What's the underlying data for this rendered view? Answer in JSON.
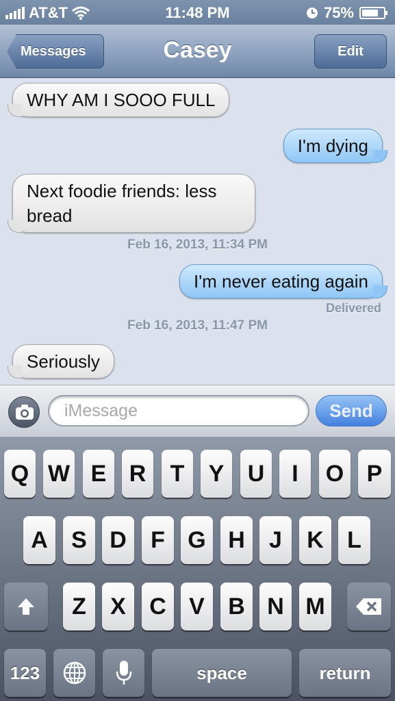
{
  "status_bar": {
    "carrier": "AT&T",
    "time": "11:48 PM",
    "battery_percent": "75%",
    "battery_level": 0.75,
    "icons": [
      "signal-icon",
      "wifi-icon",
      "clock-icon",
      "battery-icon"
    ]
  },
  "nav": {
    "back_label": "Messages",
    "title": "Casey",
    "edit_label": "Edit"
  },
  "messages": [
    {
      "direction": "in",
      "text": "WHY AM I SOOO FULL"
    },
    {
      "direction": "out",
      "text": "I'm dying"
    },
    {
      "direction": "in",
      "text": "Next foodie friends: less bread"
    },
    {
      "direction": "out",
      "text": "I'm never eating again"
    },
    {
      "direction": "in",
      "text": "Seriously"
    }
  ],
  "timestamps": [
    "Feb 16, 2013, 11:34 PM",
    "Feb 16, 2013, 11:47 PM"
  ],
  "delivered_label": "Delivered",
  "composer": {
    "placeholder": "iMessage",
    "value": "",
    "send_label": "Send"
  },
  "keyboard": {
    "row1": [
      "Q",
      "W",
      "E",
      "R",
      "T",
      "Y",
      "U",
      "I",
      "O",
      "P"
    ],
    "row2": [
      "A",
      "S",
      "D",
      "F",
      "G",
      "H",
      "J",
      "K",
      "L"
    ],
    "row3": [
      "Z",
      "X",
      "C",
      "V",
      "B",
      "N",
      "M"
    ],
    "numbers_label": "123",
    "space_label": "space",
    "return_label": "return"
  },
  "colors": {
    "incoming_bubble": "#e2e2e2",
    "outgoing_bubble": "#8fc6f5",
    "send_button": "#3578e0",
    "nav_bar": "#8fa4c0"
  }
}
